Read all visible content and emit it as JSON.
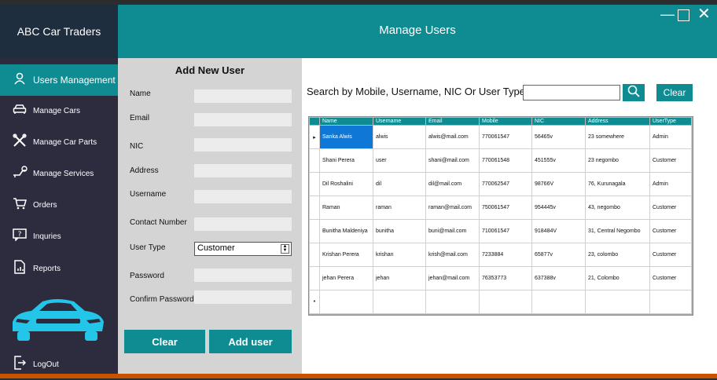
{
  "app": {
    "brand": "ABC Car Traders",
    "title": "Manage Users",
    "window_controls": {
      "minimize": "—",
      "close": "✕"
    }
  },
  "sidebar": {
    "items": [
      {
        "label": "Users Management",
        "icon": "user-icon",
        "active": true
      },
      {
        "label": "Manage Cars",
        "icon": "car-icon"
      },
      {
        "label": "Manage Car Parts",
        "icon": "tools-icon"
      },
      {
        "label": "Manage Services",
        "icon": "wrench-icon"
      },
      {
        "label": "Orders",
        "icon": "cart-icon"
      },
      {
        "label": "Inquries",
        "icon": "question-icon"
      },
      {
        "label": "Reports",
        "icon": "report-icon"
      }
    ],
    "logout": "LogOut"
  },
  "form": {
    "title": "Add New User",
    "labels": {
      "name": "Name",
      "email": "Email",
      "nic": "NIC",
      "address": "Address",
      "username": "Username",
      "contact": "Contact Number",
      "user_type": "User Type",
      "password": "Password",
      "confirm_password": "Confirm Password"
    },
    "user_type_value": "Customer",
    "clear_label": "Clear",
    "add_label": "Add user"
  },
  "search": {
    "label": "Search by Mobile, Username, NIC Or User Type",
    "value": "",
    "clear_label": "Clear"
  },
  "table": {
    "columns": [
      "Name",
      "Username",
      "Email",
      "Mobile",
      "NIC",
      "Address",
      "UserType"
    ],
    "rows": [
      [
        "Sanka Alwis",
        "alwis",
        "alwis@mail.com",
        "770061547",
        "56465v",
        "23 somewhere",
        "Admin"
      ],
      [
        "Shani Perera",
        "user",
        "shani@mail.com",
        "770061548",
        "451555v",
        "23 negombo",
        "Customer"
      ],
      [
        "Dil Roshalini",
        "dil",
        "dil@mail.com",
        "770062547",
        "98766V",
        "76, Kurunagala",
        "Admin"
      ],
      [
        "Raman",
        "raman",
        "raman@mail.com",
        "750061547",
        "954445v",
        "43, negombo",
        "Customer"
      ],
      [
        "Bunitha Maldeniya",
        "bunitha",
        "buni@mail.com",
        "710061547",
        "918484V",
        "31, Central Negombo",
        "Customer"
      ],
      [
        "Krishan Perera",
        "krishan",
        "krish@mail.com",
        "7233884",
        "65877v",
        "23, colombo",
        "Customer"
      ],
      [
        "jehan Perera",
        "jehan",
        "jehan@mail.com",
        "76353773",
        "637388v",
        "21, Colombo",
        "Customer"
      ]
    ],
    "selected_row_marker": "▸",
    "new_row_marker": "•"
  },
  "colors": {
    "accent": "#0f8c91",
    "sidebar": "#2c2c3e",
    "brand_bg": "#1e2e3e",
    "form_bg": "#d4d4d4",
    "selection": "#0f78d7"
  }
}
